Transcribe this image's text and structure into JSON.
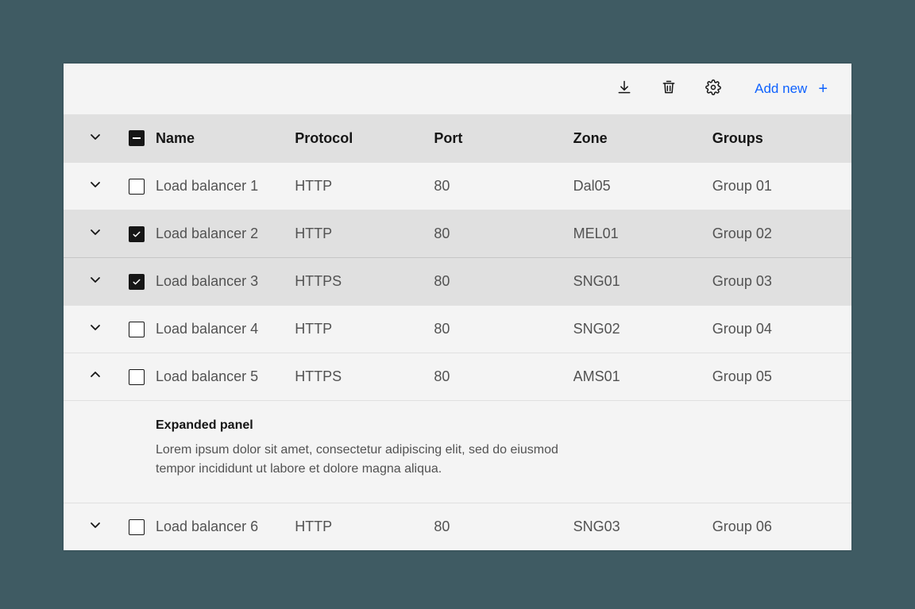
{
  "toolbar": {
    "download_icon": "download",
    "delete_icon": "trash",
    "settings_icon": "gear",
    "add_new_label": "Add new",
    "add_new_plus": "+"
  },
  "columns": {
    "name": "Name",
    "protocol": "Protocol",
    "port": "Port",
    "zone": "Zone",
    "groups": "Groups"
  },
  "header_select_state": "indeterminate",
  "rows": [
    {
      "name": "Load balancer 1",
      "protocol": "HTTP",
      "port": "80",
      "zone": "Dal05",
      "groups": "Group 01",
      "selected": false,
      "expanded": false
    },
    {
      "name": "Load balancer 2",
      "protocol": "HTTP",
      "port": "80",
      "zone": "MEL01",
      "groups": "Group 02",
      "selected": true,
      "expanded": false
    },
    {
      "name": "Load balancer 3",
      "protocol": "HTTPS",
      "port": "80",
      "zone": "SNG01",
      "groups": "Group 03",
      "selected": true,
      "expanded": false
    },
    {
      "name": "Load balancer 4",
      "protocol": "HTTP",
      "port": "80",
      "zone": "SNG02",
      "groups": "Group 04",
      "selected": false,
      "expanded": false
    },
    {
      "name": "Load balancer 5",
      "protocol": "HTTPS",
      "port": "80",
      "zone": "AMS01",
      "groups": "Group 05",
      "selected": false,
      "expanded": true
    },
    {
      "name": "Load balancer 6",
      "protocol": "HTTP",
      "port": "80",
      "zone": "SNG03",
      "groups": "Group 06",
      "selected": false,
      "expanded": false
    }
  ],
  "expanded_panel": {
    "title": "Expanded panel",
    "body": "Lorem ipsum dolor sit amet, consectetur adipiscing elit, sed do eiusmod tempor incididunt ut labore et dolore magna aliqua."
  }
}
